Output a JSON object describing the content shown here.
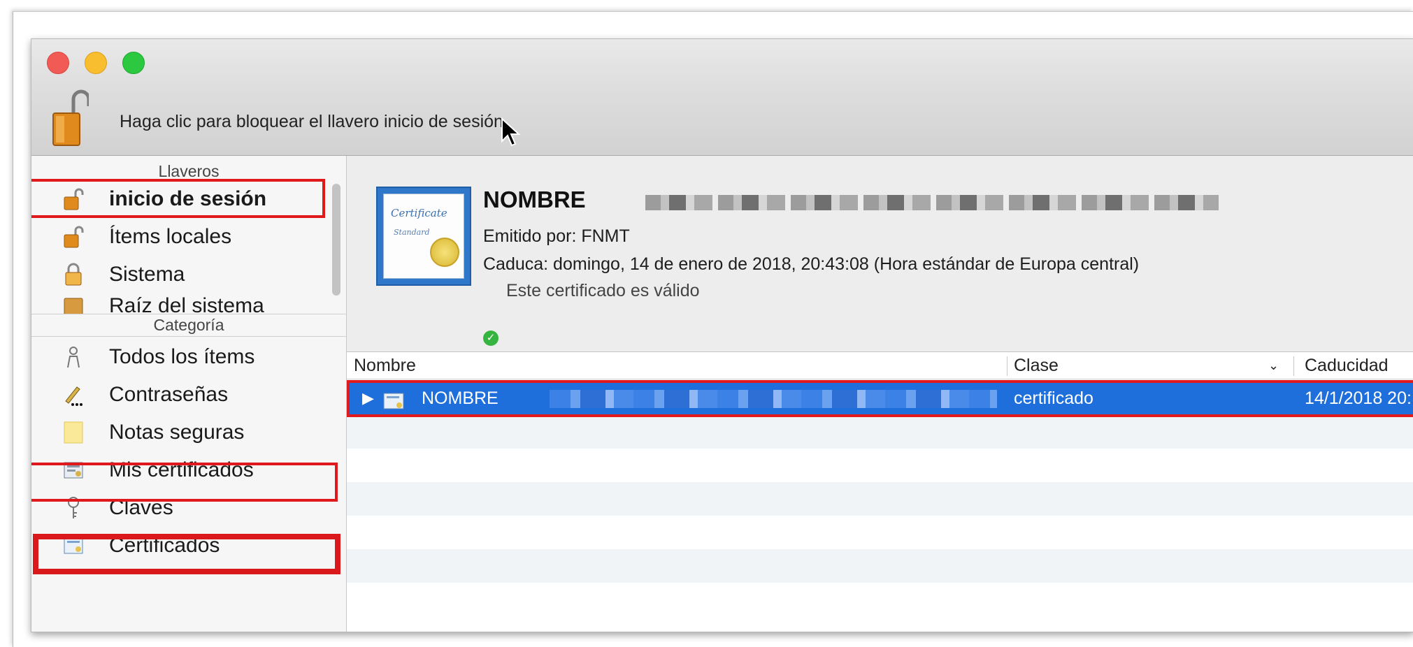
{
  "toolbar": {
    "lock_message": "Haga clic para bloquear el llavero inicio de sesión."
  },
  "sidebar": {
    "keychains_header": "Llaveros",
    "keychains": [
      {
        "label": "inicio de sesión",
        "icon": "lock-open-icon",
        "selected": true
      },
      {
        "label": "Ítems locales",
        "icon": "lock-open-icon"
      },
      {
        "label": "Sistema",
        "icon": "lock-closed-icon"
      },
      {
        "label": "Raíz del sistema",
        "icon": "lock-closed-icon"
      }
    ],
    "category_header": "Categoría",
    "categories": [
      {
        "label": "Todos los ítems",
        "icon": "people-icon"
      },
      {
        "label": "Contraseñas",
        "icon": "pen-dots-icon"
      },
      {
        "label": "Notas seguras",
        "icon": "note-icon"
      },
      {
        "label": "Mis certificados",
        "icon": "my-certificate-icon",
        "selected": true
      },
      {
        "label": "Claves",
        "icon": "key-icon"
      },
      {
        "label": "Certificados",
        "icon": "certificate-icon"
      }
    ]
  },
  "detail": {
    "name": "NOMBRE",
    "issued_by": "Emitido por: FNMT",
    "expires": "Caduca: domingo, 14 de enero de 2018, 20:43:08 (Hora estándar de Europa central)",
    "status": "Este certificado es válido",
    "cert_image_text_1": "Certificate",
    "cert_image_text_2": "Standard"
  },
  "table": {
    "columns": {
      "name": "Nombre",
      "kind": "Clase",
      "expires": "Caducidad"
    },
    "rows": [
      {
        "name": "NOMBRE",
        "kind": "certificado",
        "expires": "14/1/2018 20:"
      }
    ]
  },
  "colors": {
    "selection": "#1e6fdb",
    "highlight_box": "#e0191d",
    "valid": "#35b540"
  }
}
